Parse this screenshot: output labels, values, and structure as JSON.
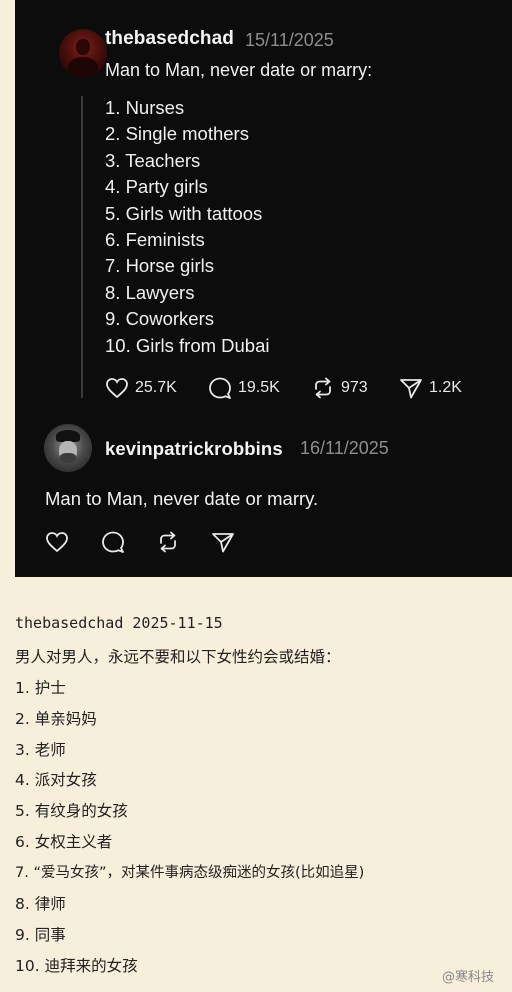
{
  "post": {
    "handle": "thebasedchad",
    "date": "15/11/2025",
    "intro": "Man to Man, never date or marry:",
    "items": [
      "1. Nurses",
      "2. Single mothers",
      "3. Teachers",
      "4. Party girls",
      "5. Girls with tattoos",
      "6. Feminists",
      "7. Horse girls",
      "8. Lawyers",
      "9. Coworkers",
      "10. Girls from Dubai"
    ],
    "stats": {
      "likes": "25.7K",
      "replies": "19.5K",
      "reposts": "973",
      "shares": "1.2K"
    }
  },
  "reply": {
    "handle": "kevinpatrickrobbins",
    "date": "16/11/2025",
    "text": "Man to Man, never date or marry."
  },
  "translation": {
    "header": "thebasedchad 2025-11-15",
    "intro": "男人对男人，永远不要和以下女性约会或结婚：",
    "items": [
      "1. 护士",
      "2. 单亲妈妈",
      "3. 老师",
      "4. 派对女孩",
      "5. 有纹身的女孩",
      "6. 女权主义者",
      "7. “爱马女孩”，对某件事病态级痴迷的女孩(比如追星)",
      "8. 律师",
      "9. 同事",
      "10. 迪拜来的女孩"
    ]
  },
  "watermark": "@寒科技",
  "icons": {
    "like": "heart-icon",
    "reply": "comment-icon",
    "repost": "repost-icon",
    "share": "send-icon"
  },
  "colors": {
    "dark_bg": "#0c0c0c",
    "page_bg": "#f8eedc",
    "muted": "#8e8e8e"
  }
}
